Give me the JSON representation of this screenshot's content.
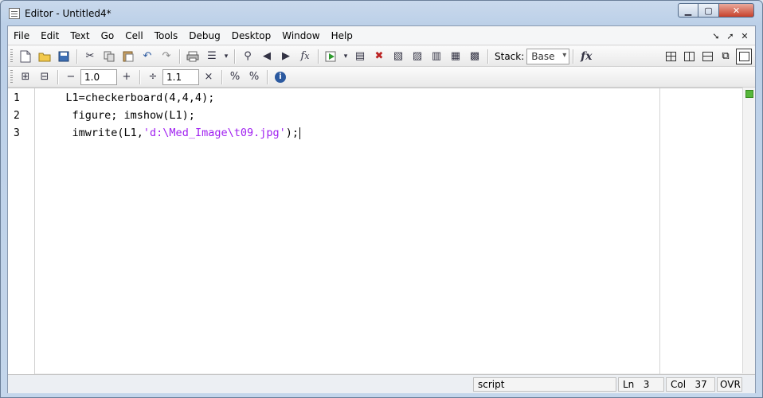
{
  "window": {
    "title": "Editor - Untitled4*",
    "controls": {
      "minimize": "▭",
      "maximize": "▢",
      "close": "✕"
    }
  },
  "menubar": {
    "items": [
      "File",
      "Edit",
      "Text",
      "Go",
      "Cell",
      "Tools",
      "Debug",
      "Desktop",
      "Window",
      "Help"
    ],
    "right_icons": [
      "undock-arrow-icon",
      "dock-arrow-icon",
      "close-icon"
    ]
  },
  "toolbar": {
    "stack_label": "Stack:",
    "stack_value": "Base",
    "fx_label": "fx"
  },
  "cell_toolbar": {
    "minus_label": "−",
    "value1": "1.0",
    "plus_label": "+",
    "divide_label": "÷",
    "value2": "1.1",
    "times_label": "×"
  },
  "editor": {
    "line_numbers": [
      "1",
      "2",
      "3"
    ],
    "lines": [
      {
        "pre": "   L1=checkerboard(4,4,4);",
        "str": "",
        "post": ""
      },
      {
        "pre": "    figure; imshow(L1);",
        "str": "",
        "post": ""
      },
      {
        "pre": "    imwrite(L1,",
        "str": "'d:\\Med_Image\\t09.jpg'",
        "post": ");"
      }
    ]
  },
  "statusbar": {
    "mode": "script",
    "ln_label": "Ln",
    "ln_value": "3",
    "col_label": "Col",
    "col_value": "37",
    "ovr": "OVR"
  },
  "colors": {
    "string": "#a020f0",
    "window_frame": "#c9d9ec",
    "close_button": "#c7412b",
    "status_ok": "#56b73a"
  }
}
